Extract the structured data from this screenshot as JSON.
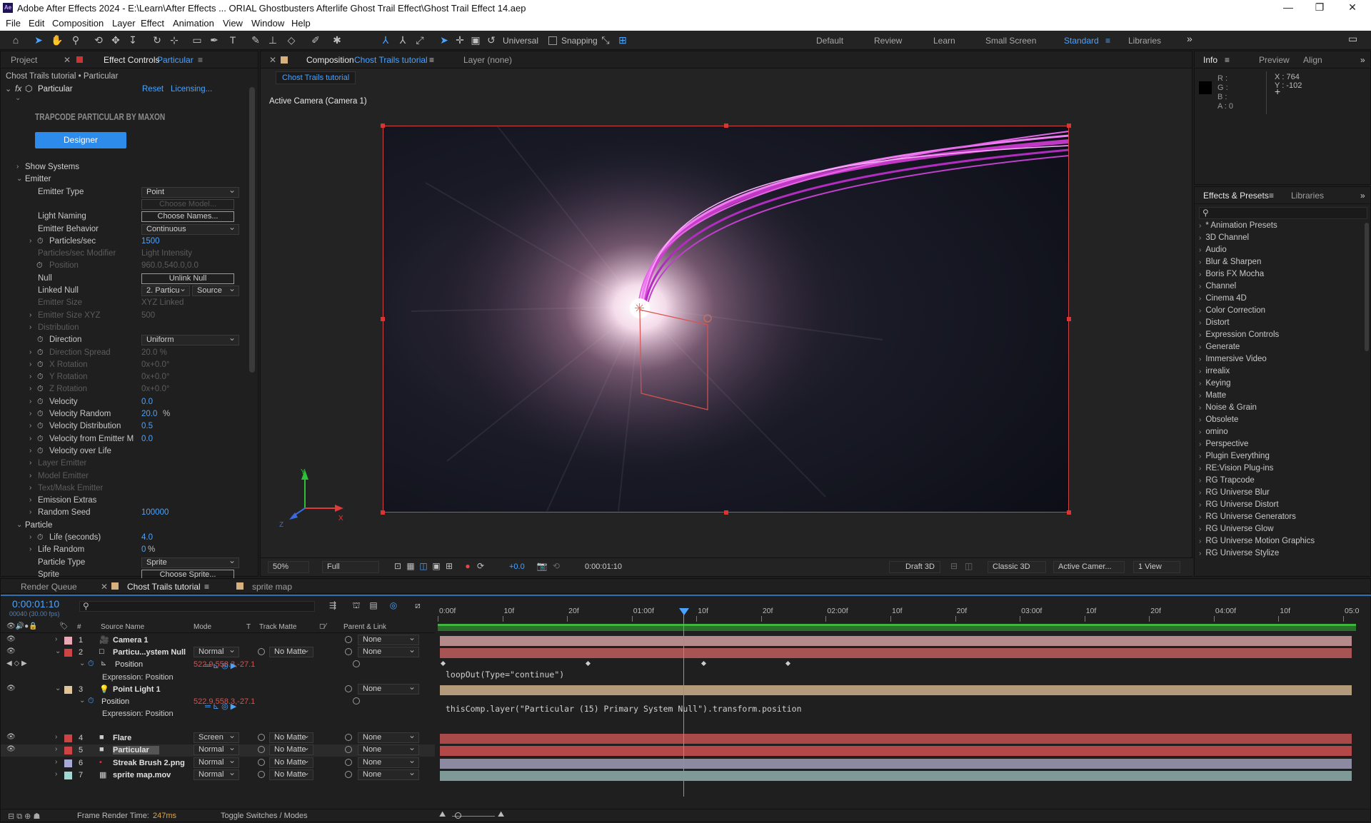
{
  "app": {
    "title": "Adobe After Effects 2024 - E:\\Learn\\After Effects ... ORIAL Ghostbusters Afterlife Ghost Trail Effect\\Ghost Trail Effect 14.aep",
    "logo": "Ae"
  },
  "menu": [
    "File",
    "Edit",
    "Composition",
    "Layer",
    "Effect",
    "Animation",
    "View",
    "Window",
    "Help"
  ],
  "toolbar": {
    "universal_label": "Universal",
    "snapping_label": "Snapping",
    "workspaces": [
      "Default",
      "Review",
      "Learn",
      "Small Screen",
      "Standard",
      "Libraries"
    ],
    "active_workspace": "Standard"
  },
  "left_panel": {
    "tab_project": "Project",
    "tab_effect_controls": "Effect Controls",
    "tab_effect_controls_target": "Particular",
    "breadcrumb": "Chost Trails tutorial • Particular",
    "effect_name": "Particular",
    "reset": "Reset",
    "licensing": "Licensing...",
    "brand": "TRAPCODE PARTICULAR BY MAXON",
    "designer_button": "Designer",
    "rows": [
      {
        "label": "Show Systems",
        "indent": 1,
        "chev": "›"
      },
      {
        "label": "Emitter",
        "indent": 1,
        "chev": "⌄"
      },
      {
        "label": "Emitter Type",
        "indent": 2,
        "dropdown": "Point"
      },
      {
        "label": "",
        "indent": 2,
        "button": "Choose Model...",
        "dim": true
      },
      {
        "label": "Light Naming",
        "indent": 2,
        "button": "Choose Names..."
      },
      {
        "label": "Emitter Behavior",
        "indent": 2,
        "dropdown": "Continuous"
      },
      {
        "label": "Particles/sec",
        "indent": 2,
        "chev": "›",
        "stop": true,
        "value": "1500"
      },
      {
        "label": "Particles/sec Modifier",
        "indent": 2,
        "dim": true,
        "value": "Light Intensity"
      },
      {
        "label": "Position",
        "indent": 3,
        "dim": true,
        "stop": true,
        "value": "960.0,540.0,0.0"
      },
      {
        "label": "Null",
        "indent": 2,
        "button": "Unlink Null"
      },
      {
        "label": "Linked Null",
        "indent": 2,
        "dropdown": "2. Particu",
        "dropdown2": "Source"
      },
      {
        "label": "Emitter Size",
        "indent": 2,
        "dim": true,
        "value": "XYZ Linked"
      },
      {
        "label": "Emitter Size XYZ",
        "indent": 2,
        "chev": "›",
        "dim": true,
        "value": "500"
      },
      {
        "label": "Distribution",
        "indent": 2,
        "chev": "›",
        "dim": true
      },
      {
        "label": "Direction",
        "indent": 2,
        "stop": true,
        "dropdown": "Uniform"
      },
      {
        "label": "Direction Spread",
        "indent": 2,
        "chev": "›",
        "stop": true,
        "dim": true,
        "value": "20.0 %"
      },
      {
        "label": "X Rotation",
        "indent": 2,
        "chev": "›",
        "stop": true,
        "dim": true,
        "value": "0x+0.0°"
      },
      {
        "label": "Y Rotation",
        "indent": 2,
        "chev": "›",
        "stop": true,
        "dim": true,
        "value": "0x+0.0°"
      },
      {
        "label": "Z Rotation",
        "indent": 2,
        "chev": "›",
        "stop": true,
        "dim": true,
        "value": "0x+0.0°"
      },
      {
        "label": "Velocity",
        "indent": 2,
        "chev": "›",
        "stop": true,
        "value": "0.0"
      },
      {
        "label": "Velocity Random",
        "indent": 2,
        "chev": "›",
        "stop": true,
        "value": "20.0",
        "suffix": "%"
      },
      {
        "label": "Velocity Distribution",
        "indent": 2,
        "chev": "›",
        "stop": true,
        "value": "0.5"
      },
      {
        "label": "Velocity from Emitter M",
        "indent": 2,
        "chev": "›",
        "stop": true,
        "value": "0.0"
      },
      {
        "label": "Velocity over Life",
        "indent": 2,
        "chev": "›",
        "stop": true
      },
      {
        "label": "Layer Emitter",
        "indent": 2,
        "chev": "›",
        "dim": true
      },
      {
        "label": "Model Emitter",
        "indent": 2,
        "chev": "›",
        "dim": true
      },
      {
        "label": "Text/Mask Emitter",
        "indent": 2,
        "chev": "›",
        "dim": true
      },
      {
        "label": "Emission Extras",
        "indent": 2,
        "chev": "›"
      },
      {
        "label": "Random Seed",
        "indent": 2,
        "chev": "›",
        "value": "100000"
      },
      {
        "label": "Particle",
        "indent": 1,
        "chev": "⌄"
      },
      {
        "label": "Life (seconds)",
        "indent": 2,
        "chev": "›",
        "stop": true,
        "value": "4.0"
      },
      {
        "label": "Life Random",
        "indent": 2,
        "chev": "›",
        "value": "0",
        "suffix": "%"
      },
      {
        "label": "Particle Type",
        "indent": 2,
        "dropdown": "Sprite"
      },
      {
        "label": "Sprite",
        "indent": 2,
        "button": "Choose Sprite..."
      }
    ]
  },
  "composition": {
    "tab_label": "Composition",
    "tab_name": "Chost Trails tutorial",
    "layer_tab": "Layer  (none)",
    "comp_chip": "Chost Trails tutorial",
    "camera_label": "Active Camera (Camera 1)",
    "axis_x": "X",
    "axis_y": "Y",
    "axis_z": "Z",
    "bottom_bar": {
      "zoom": "50%",
      "resolution": "Full",
      "exposure": "+0.0",
      "timecode": "0:00:01:10",
      "draft": "Draft 3D",
      "renderer": "Classic 3D",
      "camera": "Active Camer...",
      "views": "1 View"
    }
  },
  "info_panel": {
    "tabs": [
      "Info",
      "Preview",
      "Align"
    ],
    "r": "R :",
    "g": "G :",
    "b": "B :",
    "a": "A :  0",
    "x": "X : 764",
    "y": "Y : -102"
  },
  "effects_panel": {
    "tab": "Effects & Presets",
    "tab2": "Libraries",
    "items": [
      "* Animation Presets",
      "3D Channel",
      "Audio",
      "Blur & Sharpen",
      "Boris FX Mocha",
      "Channel",
      "Cinema 4D",
      "Color Correction",
      "Distort",
      "Expression Controls",
      "Generate",
      "Immersive Video",
      "irrealix",
      "Keying",
      "Matte",
      "Noise & Grain",
      "Obsolete",
      "omino",
      "Perspective",
      "Plugin Everything",
      "RE:Vision Plug-ins",
      "RG Trapcode",
      "RG Universe Blur",
      "RG Universe Distort",
      "RG Universe Generators",
      "RG Universe Glow",
      "RG Universe Motion Graphics",
      "RG Universe Stylize"
    ]
  },
  "timeline": {
    "tab_render_queue": "Render Queue",
    "tab_comp": "Chost Trails tutorial",
    "tab_sprite": "sprite map",
    "timecode": "0:00:01:10",
    "frame_info": "00040 (30.00 fps)",
    "col_num": "#",
    "col_source": "Source Name",
    "col_mode": "Mode",
    "col_t": "T",
    "col_trackmatte": "Track Matte",
    "col_parent": "Parent & Link",
    "ruler": [
      "0:00f",
      "10f",
      "20f",
      "01:00f",
      "10f",
      "20f",
      "02:00f",
      "10f",
      "20f",
      "03:00f",
      "10f",
      "20f",
      "04:00f",
      "10f",
      "05:0"
    ],
    "layers": [
      {
        "num": "1",
        "name": "Camera 1",
        "label_color": "#e7a9b6",
        "icon": "camera",
        "mode": "",
        "matte": "",
        "parent": "None",
        "bar": "#b58a8a"
      },
      {
        "num": "2",
        "name": "Particu...ystem Null",
        "label_color": "#c44",
        "icon": "solid-white",
        "mode": "Normal",
        "matte": "No Matte",
        "parent": "None",
        "bar": "#a85454",
        "expanded": true
      },
      {
        "num": "3",
        "name": "Point Light 1",
        "label_color": "#e0c59a",
        "icon": "light",
        "mode": "",
        "matte": "",
        "parent": "None",
        "bar": "#b39a7a",
        "expanded": true
      },
      {
        "num": "4",
        "name": "Flare",
        "label_color": "#c44",
        "icon": "solid-black",
        "mode": "Screen",
        "matte": "No Matte",
        "parent": "None",
        "bar": "#a84a4a"
      },
      {
        "num": "5",
        "name": "Particular",
        "label_color": "#c44",
        "icon": "solid-black",
        "mode": "Normal",
        "matte": "No Matte",
        "parent": "None",
        "bar": "#b24848",
        "selected": true
      },
      {
        "num": "6",
        "name": "Streak Brush 2.png",
        "label_color": "#a9a9d6",
        "icon": "image",
        "mode": "Normal",
        "matte": "No Matte",
        "parent": "None",
        "bar": "#8c8aa0"
      },
      {
        "num": "7",
        "name": "sprite map.mov",
        "label_color": "#9fd6d6",
        "icon": "footage",
        "mode": "Normal",
        "matte": "No Matte",
        "parent": "None",
        "bar": "#7f9a96"
      }
    ],
    "position_label": "Position",
    "position_value": "522.9,558.3,-27.1",
    "expression_label": "Expression: Position",
    "expr1": "loopOut(Type=\"continue\")",
    "expr2": "thisComp.layer(\"Particular (15) Primary System Null\").transform.position",
    "frame_render_label": "Frame Render Time:",
    "frame_render_value": "247ms",
    "toggle_label": "Toggle Switches / Modes"
  },
  "colors": {
    "accent": "#4aa3ff",
    "designer_button": "#2d8ceb",
    "trail": "#d43cd6"
  }
}
